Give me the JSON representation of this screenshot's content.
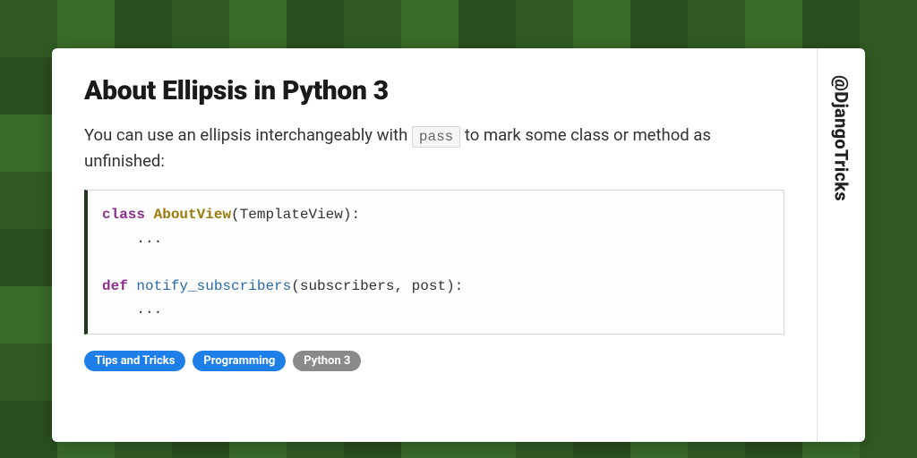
{
  "title": "About Ellipsis in Python 3",
  "description_pre": "You can use an ellipsis interchangeably with ",
  "description_code": "pass",
  "description_post": " to mark some class or method as unfinished:",
  "code": {
    "kw_class": "class",
    "class_name": "AboutView",
    "class_sig_rest": "(TemplateView):",
    "ellipsis1": "    ...",
    "blank": "",
    "kw_def": "def",
    "fn_name": " notify_subscribers",
    "fn_sig_rest": "(subscribers, post):",
    "ellipsis2": "    ..."
  },
  "tags": {
    "t0": "Tips and Tricks",
    "t1": "Programming",
    "t2": "Python 3"
  },
  "handle": "@DjangoTricks"
}
